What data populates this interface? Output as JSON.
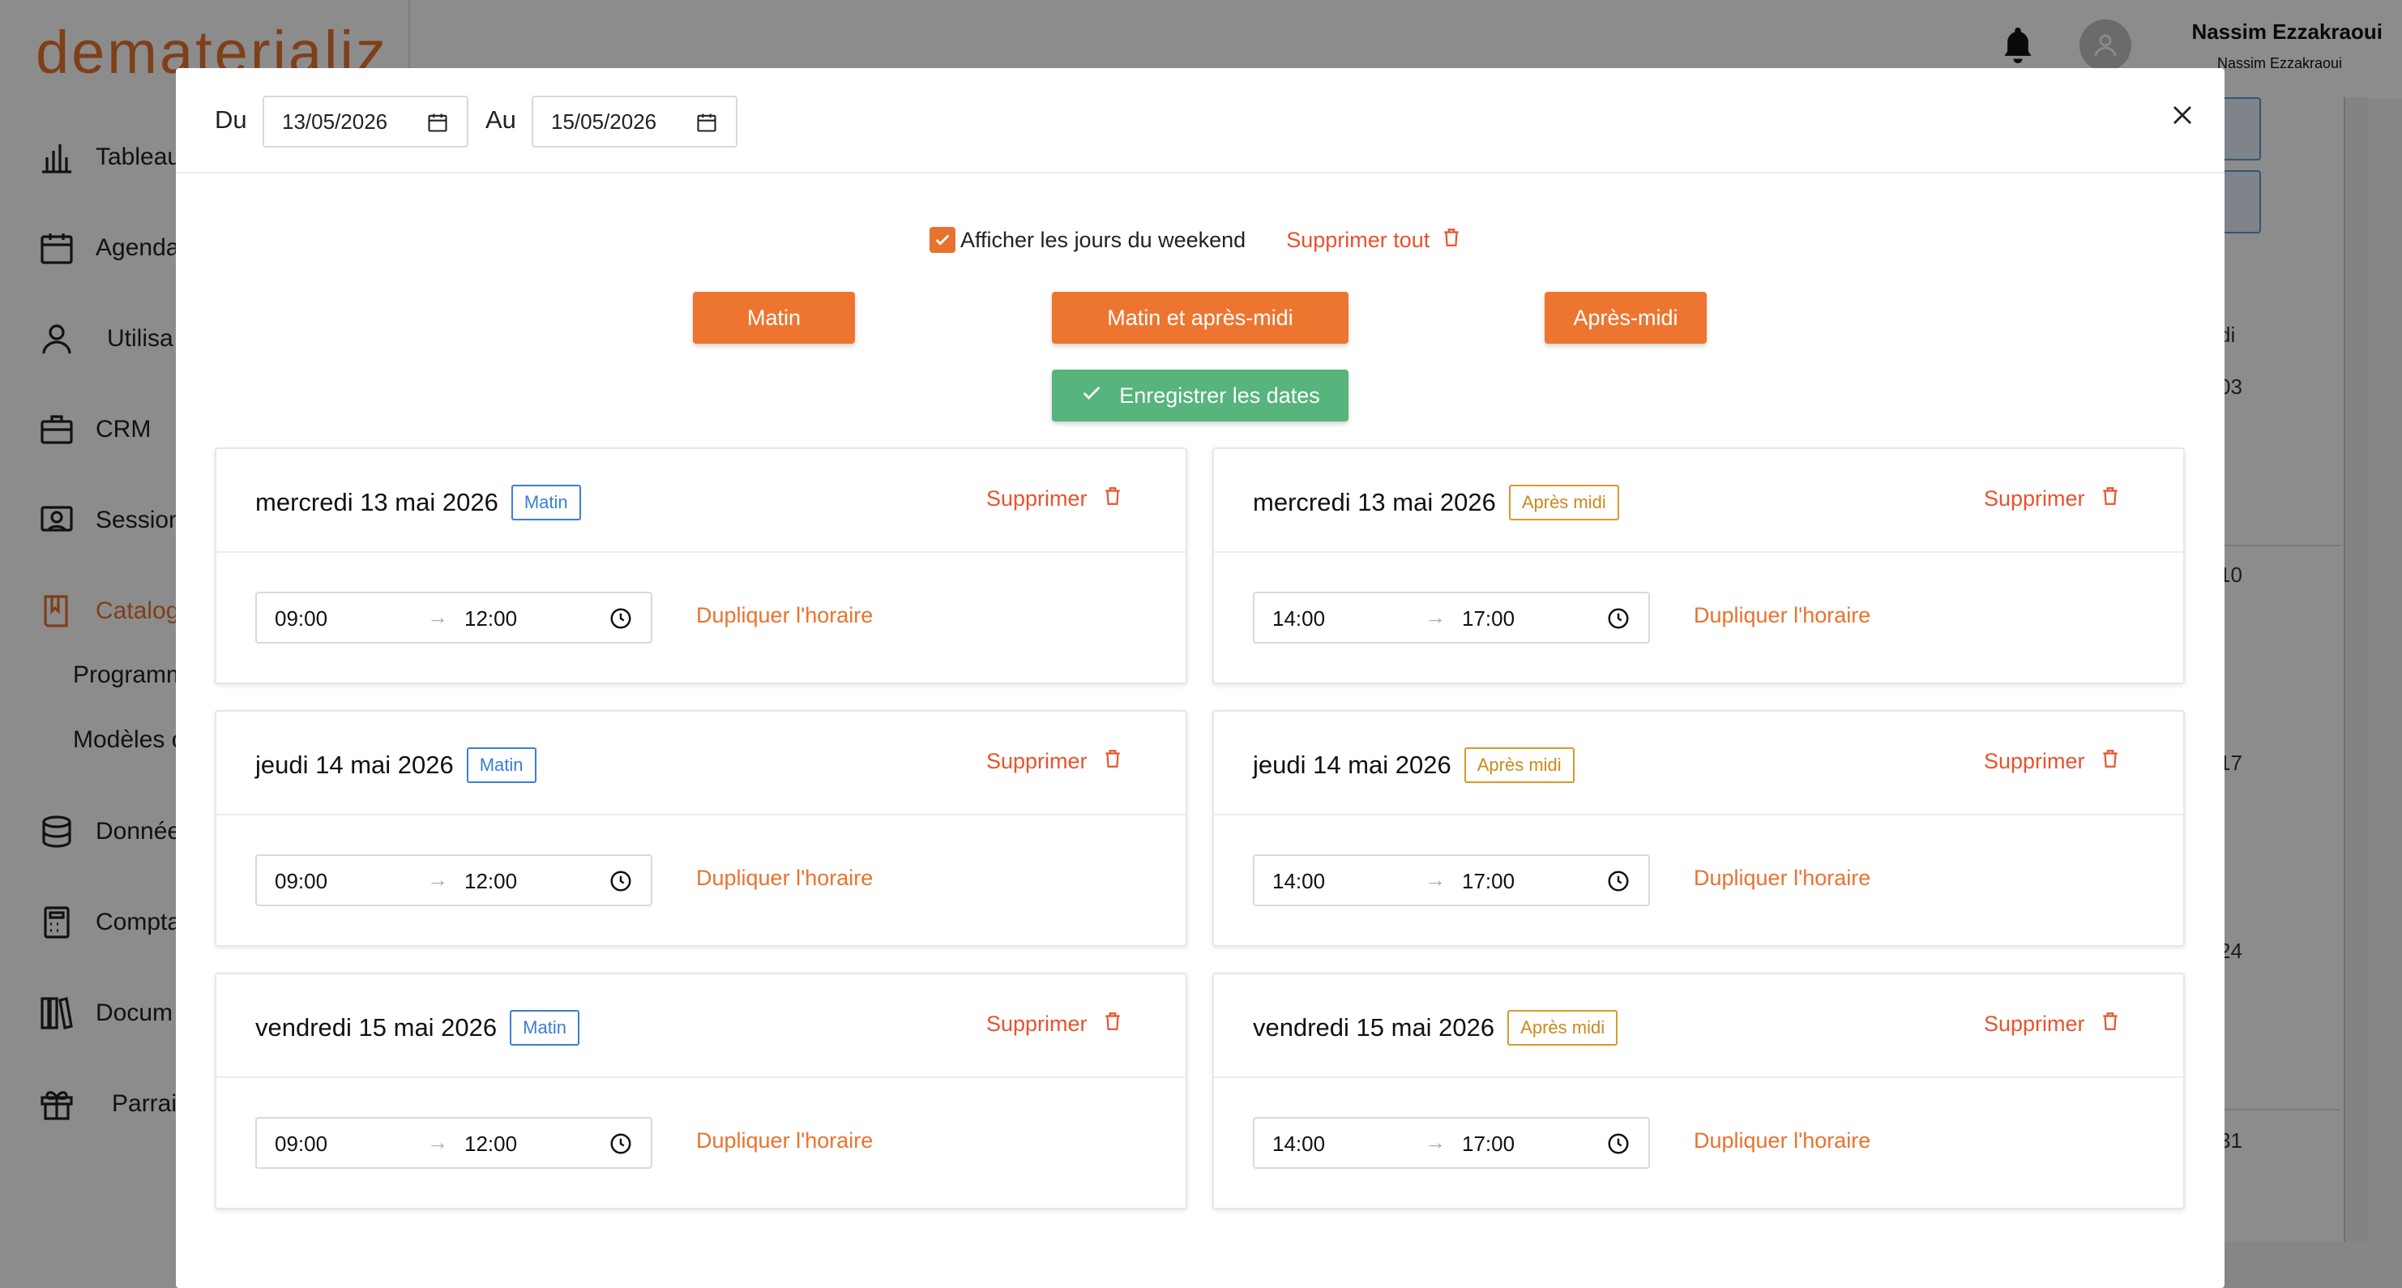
{
  "app": {
    "logo": "dematerializ",
    "user_name": "Nassim Ezzakraoui",
    "user_sub": "Nassim Ezzakraoui"
  },
  "sidebar": {
    "items": [
      {
        "label": "Tableau",
        "icon": "bar-chart-icon"
      },
      {
        "label": "Agenda",
        "icon": "calendar-icon"
      },
      {
        "label": "Utilisa",
        "icon": "user-icon"
      },
      {
        "label": "CRM",
        "icon": "briefcase-icon"
      },
      {
        "label": "Session",
        "icon": "presentation-icon"
      },
      {
        "label": "Catalog",
        "icon": "book-icon"
      },
      {
        "label": "Donnée",
        "icon": "database-icon"
      },
      {
        "label": "Compta",
        "icon": "calculator-icon"
      },
      {
        "label": "Docum",
        "icon": "books-icon"
      },
      {
        "label": "Parrai",
        "icon": "gift-icon"
      }
    ],
    "subitems": [
      "Programm",
      "Modèles c"
    ]
  },
  "background": {
    "col_header": "di",
    "values": [
      "03",
      "10",
      "17",
      "24",
      "31"
    ]
  },
  "modal": {
    "from_label": "Du",
    "from_date": "13/05/2026",
    "to_label": "Au",
    "to_date": "15/05/2026",
    "weekend_label": "Afficher les jours du weekend",
    "weekend_checked": true,
    "delete_all_label": "Supprimer tout",
    "btn_morning": "Matin",
    "btn_both": "Matin et après-midi",
    "btn_afternoon": "Après-midi",
    "btn_save": "Enregistrer les dates",
    "accent_color": "#ee7530",
    "save_color": "#56b47c"
  },
  "slots": [
    {
      "date": "mercredi 13 mai 2026",
      "badge": "Matin",
      "start": "09:00",
      "end": "12:00"
    },
    {
      "date": "mercredi 13 mai 2026",
      "badge": "Après midi",
      "start": "14:00",
      "end": "17:00"
    },
    {
      "date": "jeudi 14 mai 2026",
      "badge": "Matin",
      "start": "09:00",
      "end": "12:00"
    },
    {
      "date": "jeudi 14 mai 2026",
      "badge": "Après midi",
      "start": "14:00",
      "end": "17:00"
    },
    {
      "date": "vendredi 15 mai 2026",
      "badge": "Matin",
      "start": "09:00",
      "end": "12:00"
    },
    {
      "date": "vendredi 15 mai 2026",
      "badge": "Après midi",
      "start": "14:00",
      "end": "17:00"
    }
  ],
  "card_labels": {
    "delete": "Supprimer",
    "duplicate": "Dupliquer l'horaire",
    "arrow": "→"
  }
}
